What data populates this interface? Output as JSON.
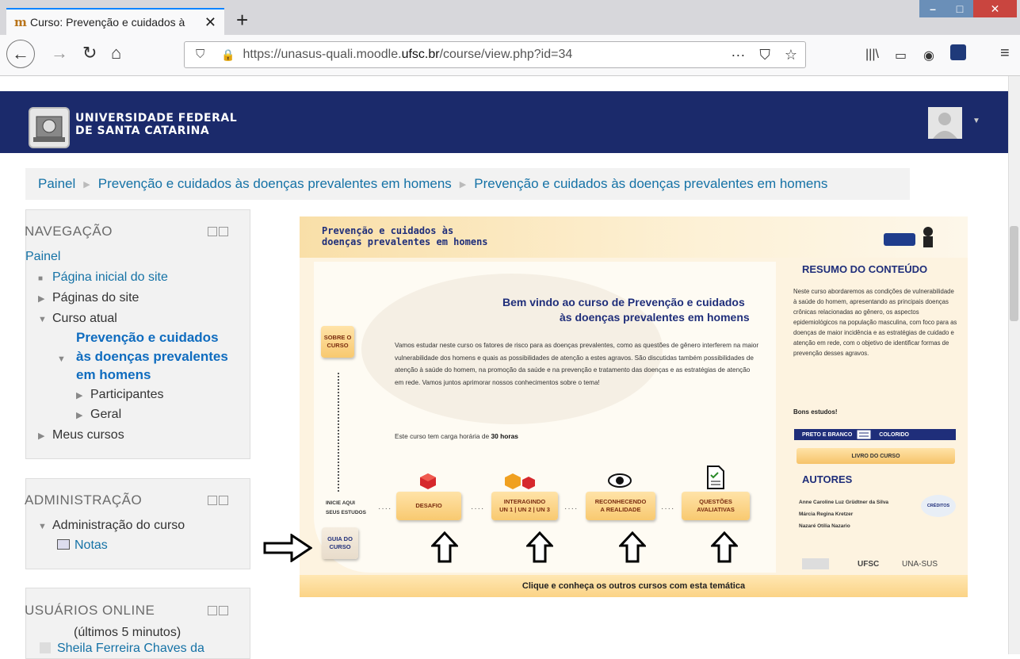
{
  "browser": {
    "tab_title": "Curso: Prevenção e cuidados à",
    "url_prefix": "https://unasus-quali.moodle.",
    "url_domain": "ufsc.br",
    "url_path": "/course/view.php?id=34"
  },
  "header": {
    "univ_line1": "UNIVERSIDADE FEDERAL",
    "univ_line2": "DE SANTA CATARINA"
  },
  "breadcrumb": {
    "items": [
      "Painel",
      "Prevenção e cuidados às doenças prevalentes em homens",
      "Prevenção e cuidados às doenças prevalentes em homens"
    ]
  },
  "navigation": {
    "title": "NAVEGAÇÃO",
    "painel": "Painel",
    "pagina_inicial": "Página inicial do site",
    "paginas_site": "Páginas do site",
    "curso_atual": "Curso atual",
    "current_course_1": "Prevenção e cuidados",
    "current_course_2": "às doenças prevalentes",
    "current_course_3": "em homens",
    "participantes": "Participantes",
    "geral": "Geral",
    "meus_cursos": "Meus cursos"
  },
  "administration": {
    "title": "ADMINISTRAÇÃO",
    "admin_curso": "Administração do curso",
    "notas": "Notas"
  },
  "online": {
    "title": "USUÁRIOS ONLINE",
    "subtitle": "(últimos 5 minutos)",
    "user": "Sheila Ferreira Chaves da"
  },
  "course": {
    "banner_title_1": "Prevenção e cuidados às",
    "banner_title_2": "doenças prevalentes em homens",
    "welcome_1": "Bem vindo ao curso de Prevenção e cuidados",
    "welcome_2": "às doenças prevalentes em homens",
    "intro": "Vamos estudar neste curso os fatores de risco para as doenças prevalentes, como as questões de gênero interferem na maior vulnerabilidade dos homens e quais as possibilidades de atenção a estes agravos. São discutidas também possibilidades de atenção à saúde do homem, na promoção da saúde e na prevenção e tratamento das doenças e as estratégias de atenção em rede. Vamos juntos aprimorar nossos conhecimentos sobre o tema!",
    "carga_prefix": "Este curso tem carga horária de ",
    "carga_hours": "30 horas",
    "sobre_1": "SOBRE O",
    "sobre_2": "CURSO",
    "inicie_1": "INICIE AQUI",
    "inicie_2": "SEUS ESTUDOS",
    "guia_1": "GUIA DO",
    "guia_2": "CURSO",
    "desafio": "DESAFIO",
    "interagindo_1": "INTERAGINDO",
    "interagindo_2": "UN 1 | UN 2 | UN 3",
    "reconhecendo_1": "RECONHECENDO",
    "reconhecendo_2": "A REALIDADE",
    "questoes_1": "QUESTÕES",
    "questoes_2": "AVALIATIVAS",
    "resumo_title": "RESUMO DO CONTEÚDO",
    "resumo_text": "Neste curso abordaremos as condições de vulnerabilidade à saúde do homem, apresentando as principais doenças crônicas relacionadas ao gênero, os aspectos epidemiológicos na população masculina, com foco para as doenças de maior incidência e as estratégias de cuidado e atenção em rede, com o objetivo de identificar formas de prevenção desses agravos.",
    "bons_estudos": "Bons estudos!",
    "preto_branco": "PRETO E BRANCO",
    "colorido": "COLORIDO",
    "livro": "LIVRO DO CURSO",
    "autores_title": "AUTORES",
    "autor_1": "Anne Caroline Luz Grüdtner da Silva",
    "autor_2": "Márcia Regina Kretzer",
    "autor_3": "Nazaré Otília Nazario",
    "creditos": "CRÉDITOS",
    "logo_ufsc": "UFSC",
    "logo_unasus": "UNA-SUS",
    "clique": "Clique e conheça os outros cursos com esta temática"
  }
}
